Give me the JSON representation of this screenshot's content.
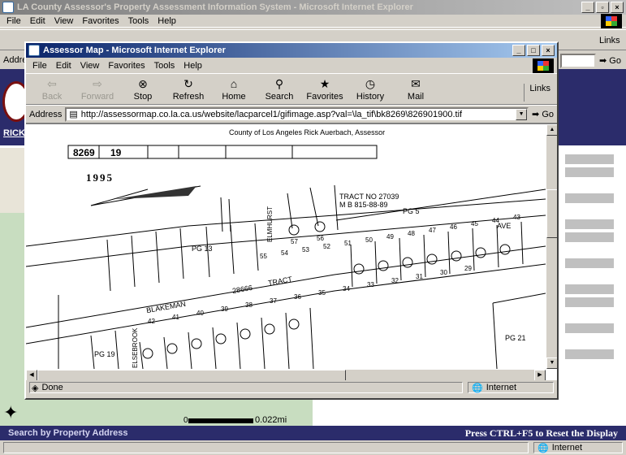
{
  "main_window": {
    "title": "LA County Assessor's Property Assessment Information System - Microsoft Internet Explorer",
    "menu": [
      "File",
      "Edit",
      "View",
      "Favorites",
      "Tools",
      "Help"
    ],
    "links_label": "Links",
    "go_label": "Go",
    "address_label": "Addre",
    "left_tag": "RICK A",
    "search_label": "Search by Property Address",
    "reset_hint": "Press CTRL+F5 to Reset the Display",
    "scale_label": "0.022mi",
    "scale_zero": "0",
    "status_zone": "Internet"
  },
  "popup_window": {
    "title": "Assessor Map - Microsoft Internet Explorer",
    "menu": [
      "File",
      "Edit",
      "View",
      "Favorites",
      "Tools",
      "Help"
    ],
    "toolbar": [
      {
        "label": "Back",
        "icon": "back-arrow-icon",
        "disabled": true
      },
      {
        "label": "Forward",
        "icon": "forward-arrow-icon",
        "disabled": true
      },
      {
        "label": "Stop",
        "icon": "stop-icon",
        "disabled": false
      },
      {
        "label": "Refresh",
        "icon": "refresh-icon",
        "disabled": false
      },
      {
        "label": "Home",
        "icon": "home-icon",
        "disabled": false
      },
      {
        "label": "Search",
        "icon": "search-icon",
        "disabled": false
      },
      {
        "label": "Favorites",
        "icon": "favorites-icon",
        "disabled": false
      },
      {
        "label": "History",
        "icon": "history-icon",
        "disabled": false
      },
      {
        "label": "Mail",
        "icon": "mail-icon",
        "disabled": false
      }
    ],
    "links_label": "Links",
    "address_label": "Address",
    "url": "http://assessormap.co.la.ca.us/website/lacparcel1/gifimage.asp?val=\\la_tif\\bk8269\\826901900.tif",
    "go_label": "Go",
    "status_text": "Done",
    "status_zone": "Internet"
  },
  "map": {
    "header": "County of Los Angeles   Rick Auerbach,  Assessor",
    "book": "8269",
    "page": "19",
    "year": "1995",
    "tract_label": "TRACT NO 27039",
    "tract_mb": "M B  815-88-89",
    "street_1": "BLAKEMAN",
    "street_2": "ELMHURST",
    "street_3": "AVE",
    "street_4": "ELSEBROOK",
    "tract_2": "TRACT",
    "tract_2_no": "28666",
    "pg_labels": [
      "PG 5",
      "PG 13",
      "PG 19",
      "PG 21"
    ],
    "lot_numbers": [
      "57",
      "56",
      "55",
      "54",
      "53",
      "52",
      "51",
      "50",
      "49",
      "48",
      "47",
      "46",
      "45",
      "44",
      "43",
      "42",
      "41",
      "40",
      "39",
      "38",
      "37",
      "36",
      "35",
      "34",
      "33",
      "32",
      "31",
      "30",
      "29"
    ]
  },
  "colors": {
    "title_active": "#0a246a",
    "app_header_blue": "#2b2c6b",
    "parcel_green": "#c8ddc0"
  }
}
